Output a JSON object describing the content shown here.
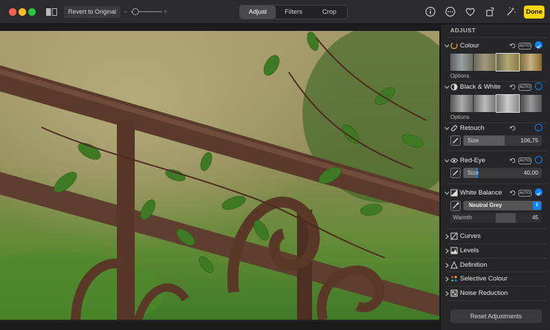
{
  "toolbar": {
    "revert_label": "Revert to Original",
    "zoom_minus": "−",
    "zoom_plus": "+",
    "zoom_level": 0.05,
    "tabs": [
      {
        "label": "Adjust",
        "active": true
      },
      {
        "label": "Filters",
        "active": false
      },
      {
        "label": "Crop",
        "active": false
      }
    ],
    "done_label": "Done",
    "icons": [
      "info-icon",
      "more-icon",
      "heart-icon",
      "rotate-icon",
      "magic-wand-icon"
    ]
  },
  "sidebar": {
    "title": "ADJUST",
    "colour": {
      "label": "Colour",
      "auto": "AUTO",
      "enabled": true,
      "options": "Options"
    },
    "bw": {
      "label": "Black & White",
      "auto": "AUTO",
      "enabled": false,
      "options": "Options"
    },
    "retouch": {
      "label": "Retouch",
      "slider_name": "Size",
      "slider_value": "106,75",
      "fraction": 0.53
    },
    "redeye": {
      "label": "Red-Eye",
      "auto": "AUTO",
      "slider_name": "Size",
      "slider_value": "40,00",
      "fraction": 0.18
    },
    "wb": {
      "label": "White Balance",
      "auto": "AUTO",
      "enabled": true,
      "mode": "Neutral Grey",
      "warmth_name": "Warmth",
      "warmth_value": "45"
    },
    "sections": [
      "Curves",
      "Levels",
      "Definition",
      "Selective Colour",
      "Noise Reduction"
    ],
    "reset_label": "Reset Adjustments"
  },
  "colors": {
    "accent": "#0a84ff",
    "done": "#ffd60a"
  }
}
